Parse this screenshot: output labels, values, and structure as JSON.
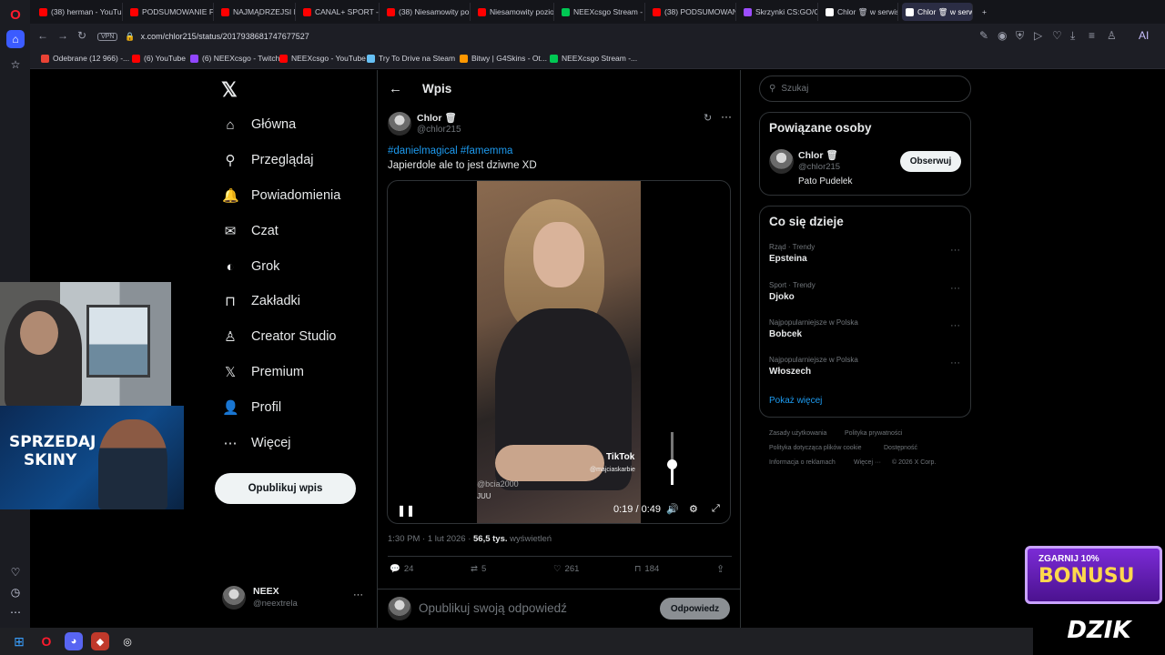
{
  "browser": {
    "tabs": [
      {
        "label": "(38) herman - YouTub",
        "color": "#ff0000"
      },
      {
        "label": "PODSUMOWANIE FA",
        "color": "#ff0000"
      },
      {
        "label": "NAJMĄDRZEJSI POLI",
        "color": "#ff0000"
      },
      {
        "label": "CANAL+ SPORT - Yo",
        "color": "#ff0000"
      },
      {
        "label": "(38) Niesamowity po",
        "color": "#ff0000"
      },
      {
        "label": "Niesamowity poziom",
        "color": "#ff0000"
      },
      {
        "label": "NEEXcsgo Stream - V",
        "color": "#00c853"
      },
      {
        "label": "(38) PODSUMOWAN",
        "color": "#ff0000"
      },
      {
        "label": "Skrzynki CS:GO/CS2 |",
        "color": "#9c4dff"
      },
      {
        "label": "Chlor 🗑 w serwisie",
        "color": "#ffffff"
      },
      {
        "label": "Chlor 🗑 w serwisie X",
        "color": "#ffffff"
      }
    ],
    "new_tab": "+",
    "vpn_label": "VPN",
    "url": "x.com/chlor215/status/2017938681747677527",
    "ai_label": "AI",
    "bookmarks": [
      {
        "label": "Odebrane (12 966) -...",
        "color": "#ea4335"
      },
      {
        "label": "(6) YouTube",
        "color": "#ff0000"
      },
      {
        "label": "(6) NEEXcsgo - Twitch",
        "color": "#9146ff"
      },
      {
        "label": "NEEXcsgo - YouTube",
        "color": "#ff0000"
      },
      {
        "label": "Try To Drive na Steam",
        "color": "#66c0f4"
      },
      {
        "label": "Bitwy | G4Skins - Ot...",
        "color": "#ff9800"
      },
      {
        "label": "NEEXcsgo Stream -...",
        "color": "#00c853"
      }
    ]
  },
  "sidebar": {
    "items": [
      {
        "label": "Główna",
        "icon": "home-icon",
        "glyph": "⌂"
      },
      {
        "label": "Przeglądaj",
        "icon": "search-icon",
        "glyph": "⚲"
      },
      {
        "label": "Powiadomienia",
        "icon": "bell-icon",
        "glyph": "🔔"
      },
      {
        "label": "Czat",
        "icon": "mail-icon",
        "glyph": "✉"
      },
      {
        "label": "Grok",
        "icon": "grok-icon",
        "glyph": "◐"
      },
      {
        "label": "Zakładki",
        "icon": "bookmark-icon",
        "glyph": "⊓"
      },
      {
        "label": "Creator Studio",
        "icon": "creator-studio-icon",
        "glyph": "♙"
      },
      {
        "label": "Premium",
        "icon": "x-premium-icon",
        "glyph": "𝕏"
      },
      {
        "label": "Profil",
        "icon": "person-icon",
        "glyph": "👤"
      },
      {
        "label": "Więcej",
        "icon": "more-circle-icon",
        "glyph": "⋯"
      }
    ],
    "post_button": "Opublikuj wpis",
    "account": {
      "name": "NEEX",
      "handle": "@neextrela",
      "more": "···"
    }
  },
  "post": {
    "header_title": "Wpis",
    "author_name": "Chlor 🗑",
    "author_handle": "@chlor215",
    "hashtags": "#danielmagical #famemma",
    "text": "Japierdole ale to jest dziwne XD",
    "video": {
      "time_current": "0:19",
      "time_total": "0:49",
      "watermark": "TikTok",
      "watermark_user": "@majciaskarbie",
      "overlay_text": "@bcia2000",
      "overlay_text2": "JUU",
      "volume_fraction": 0.4
    },
    "meta_time": "1:30 PM · 1 lut 2026 ·",
    "views_count": "56,5 tys.",
    "views_label": "wyświetleń",
    "stats": {
      "replies": "24",
      "reposts": "5",
      "likes": "261",
      "bookmarks": "184"
    },
    "reply_placeholder": "Opublikuj swoją odpowiedź",
    "reply_button": "Odpowiedz"
  },
  "right": {
    "search_placeholder": "Szukaj",
    "related_title": "Powiązane osoby",
    "related_person": {
      "name": "Chlor 🗑",
      "handle": "@chlor215",
      "bio": "Pato Pudelek",
      "follow_label": "Obserwuj"
    },
    "trends_title": "Co się dzieje",
    "trends": [
      {
        "context": "Rząd · Trendy",
        "name": "Epsteina"
      },
      {
        "context": "Sport · Trendy",
        "name": "Djoko"
      },
      {
        "context": "Najpopularniejsze w Polska",
        "name": "Bobcek"
      },
      {
        "context": "Najpopularniejsze w Polska",
        "name": "Włoszech"
      }
    ],
    "show_more": "Pokaż więcej",
    "footer": {
      "terms": "Zasady użytkowania",
      "privacy": "Polityka prywatności",
      "cookies": "Polityka dotycząca plików cookie",
      "accessibility": "Dostępność",
      "ads": "Informacja o reklamach",
      "more": "Więcej ···",
      "copyright": "© 2026 X Corp."
    }
  },
  "overlays": {
    "skins_line1": "SPRZEDAJ",
    "skins_line2": "SKINY",
    "bonus_line1": "ZGARNIJ 10%",
    "bonus_line2": "BONUSU",
    "dzik": "DZIK"
  },
  "colors": {
    "accent": "#1d9bf0",
    "background": "#000000",
    "opera_red": "#ff1b2d"
  }
}
